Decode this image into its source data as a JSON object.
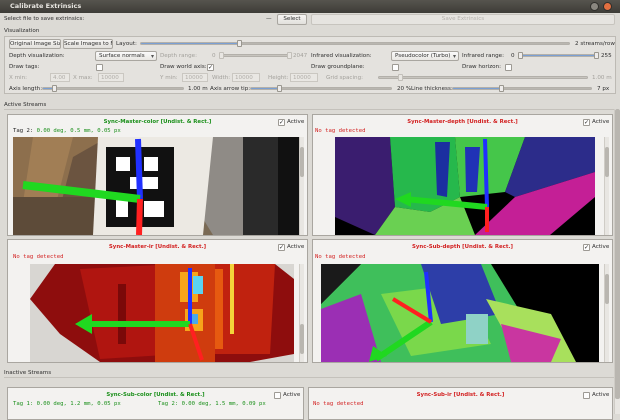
{
  "window": {
    "title": "Calibrate Extrinsics"
  },
  "file_row": {
    "label": "Select file to save extrinsics:",
    "path_dash": "—",
    "select_button": "Select",
    "save_button": "Save Extrinsics"
  },
  "visualization": {
    "section_label": "Visualization",
    "original_size_button": "Original Image Size",
    "scale_fit_button": "Scale Images to Fit",
    "layout_label": "Layout:",
    "layout_value_text": "2 streams/row",
    "layout_value": 0.5,
    "depth_vis_label": "Depth visualization:",
    "depth_vis_value": "Surface normals",
    "depth_range_label": "Depth range:",
    "depth_range_min": "0",
    "depth_range_max": "2047",
    "ir_vis_label": "Infrared visualization:",
    "ir_vis_value": "Pseudocolor (Turbo)",
    "ir_range_label": "Infrared range:",
    "ir_range_min": "0",
    "ir_range_max": "255",
    "draw_tags_label": "Draw tags:",
    "draw_world_axis_label": "Draw world axis:",
    "draw_world_axis_checked": "✓",
    "draw_groundplane_label": "Draw groundplane:",
    "draw_horizon_label": "Draw horizon:",
    "x_min_label": "X min:",
    "x_min_value": "4.00",
    "x_max_label": "X max:",
    "x_max_value": "10000",
    "width_label": "Width:",
    "width_value": "10000",
    "height_label": "Height:",
    "height_value": "10000",
    "grid_spacing_label": "Grid spacing:",
    "grid_spacing_value": "1.00 m",
    "axis_length_label": "Axis length:",
    "axis_length_value": "1.00 m",
    "arrow_tip_label": "Axis arrow tip:",
    "arrow_tip_value": "20 %",
    "line_thickness_label": "Line thickness:",
    "line_thickness_value": "7 px"
  },
  "active_streams": {
    "section_label": "Active Streams",
    "active_label": "Active",
    "active_check": "✓",
    "panels": [
      {
        "title": "Sync-Master-color [Undist. & Rect.]",
        "status": "Tag 2: 0.00 deg, 0.5 mm, 0.05 px"
      },
      {
        "title": "Sync-Master-depth [Undist. & Rect.]",
        "status": "No tag detected"
      },
      {
        "title": "Sync-Master-ir [Undist. & Rect.]",
        "status": "No tag detected"
      },
      {
        "title": "Sync-Sub-depth [Undist. & Rect.]",
        "status": "No tag detected"
      }
    ]
  },
  "inactive_streams": {
    "section_label": "Inactive Streams",
    "active_label": "Active",
    "panels": [
      {
        "title": "Sync-Sub-color [Undist. & Rect.]",
        "status": "Tag 1: 0.00 deg, 1.2 mm, 0.05 px",
        "status2": "Tag 2: 0.00 deg, 1.5 mm, 0.09 px"
      },
      {
        "title": "Sync-Sub-ir [Undist. & Rect.]",
        "status": "No tag detected"
      }
    ]
  },
  "colors": {
    "tag_ok": "#1a8f1a",
    "no_tag": "#d21f1f",
    "axis_x": "#1fd11f",
    "axis_y": "#ff2020",
    "axis_z": "#2040ff"
  }
}
